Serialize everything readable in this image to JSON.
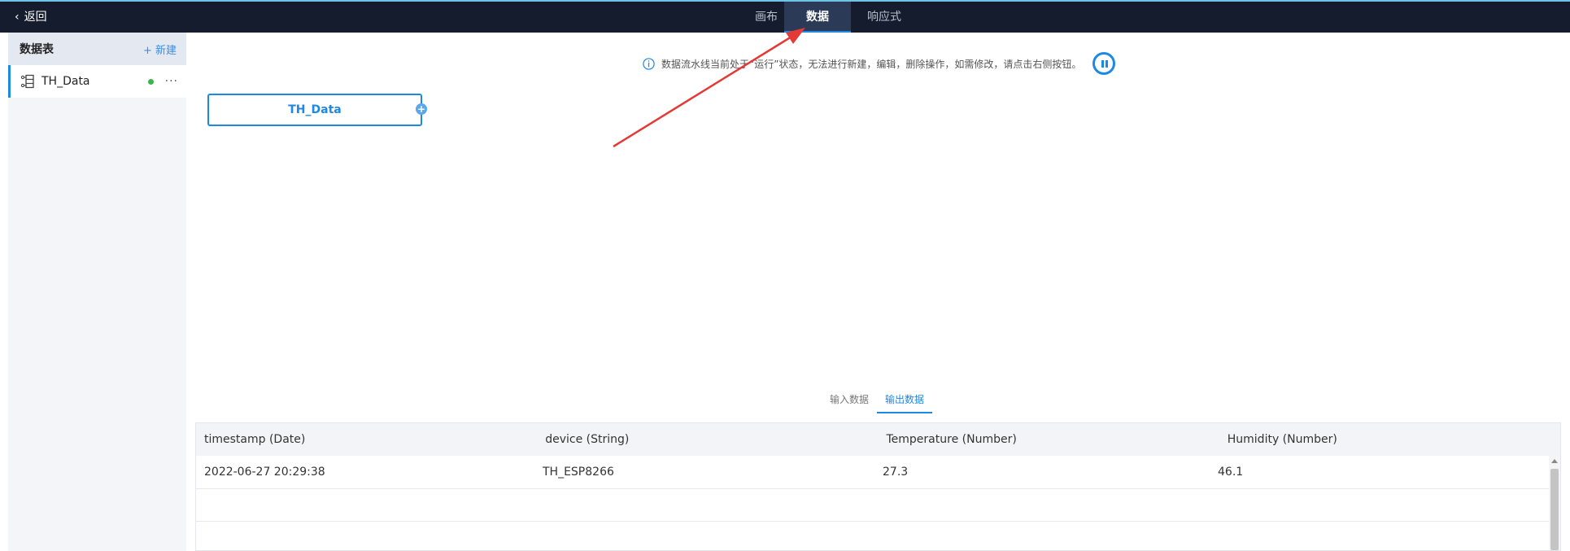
{
  "topbar": {
    "back_label": "返回",
    "tabs": [
      {
        "label": "画布"
      },
      {
        "label": "数据"
      },
      {
        "label": "响应式"
      }
    ]
  },
  "sidebar": {
    "title": "数据表",
    "new_label": "+ 新建",
    "items": [
      {
        "label": "TH_Data",
        "status": "running",
        "more": "···"
      }
    ]
  },
  "notice": {
    "text": "数据流水线当前处于“运行”状态，无法进行新建，编辑，删除操作，如需修改，请点击右侧按钮。"
  },
  "canvas": {
    "node_label": "TH_Data",
    "node_add_symbol": "+"
  },
  "data_tabs": [
    {
      "label": "输入数据"
    },
    {
      "label": "输出数据"
    }
  ],
  "table": {
    "columns": [
      "timestamp (Date)",
      "device (String)",
      "Temperature (Number)",
      "Humidity (Number)"
    ],
    "rows": [
      [
        "2022-06-27 20:29:38",
        "TH_ESP8266",
        "27.3",
        "46.1"
      ]
    ]
  },
  "colors": {
    "topbar_bg": "#141c2e",
    "accent": "#1e88e5",
    "annotation_arrow": "#e53935",
    "status_running": "#3cb44b"
  }
}
